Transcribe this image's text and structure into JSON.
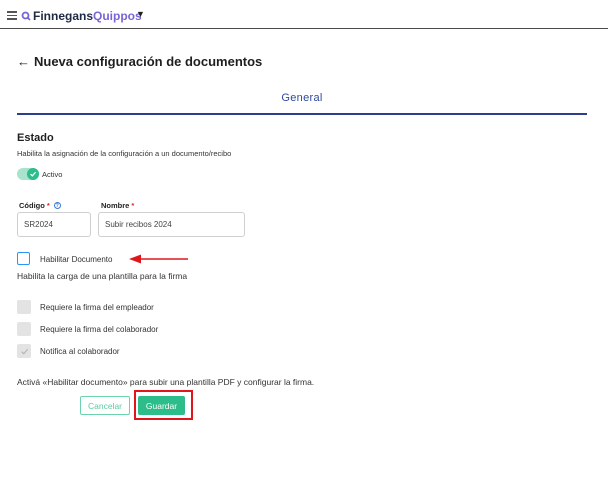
{
  "header": {
    "brand_part1": "Finnegans",
    "brand_part2": "Quippos"
  },
  "page": {
    "title": "Nueva configuración de documentos",
    "tabs": [
      {
        "label": "General",
        "active": true
      }
    ]
  },
  "estado": {
    "title": "Estado",
    "description": "Habilita la asignación de la configuración a un documento/recibo",
    "toggle_label": "Activo",
    "toggle_on": true
  },
  "fields": {
    "codigo": {
      "label": "Código",
      "required_mark": "*",
      "value": "SR2024"
    },
    "nombre": {
      "label": "Nombre",
      "required_mark": "*",
      "value": "Subir recibos 2024"
    }
  },
  "habilitar": {
    "label": "Habilitar Documento",
    "checked": false,
    "description": "Habilita la carga de una plantilla para la firma"
  },
  "options": [
    {
      "label": "Requiere la firma del empleador",
      "checked": false
    },
    {
      "label": "Requiere la firma del colaborador",
      "checked": false
    },
    {
      "label": "Notifica al colaborador",
      "checked": true
    }
  ],
  "note": "Activá «Habilitar documento» para subir una plantilla PDF y configurar la firma.",
  "actions": {
    "cancel_label": "Cancelar",
    "save_label": "Guardar"
  },
  "colors": {
    "accent_green": "#2dbd8a",
    "tab_blue": "#2d3e8f",
    "highlight_red": "#e0161d",
    "brand_purple": "#7a64d6"
  }
}
